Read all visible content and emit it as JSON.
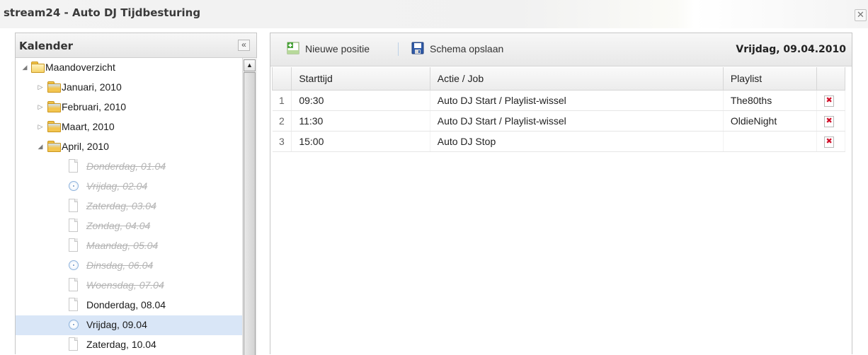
{
  "window": {
    "title": "stream24 - Auto DJ Tijdbesturing",
    "close_label": "✕"
  },
  "calendar": {
    "title": "Kalender",
    "collapse_label": "«",
    "root": "Maandoverzicht",
    "months": [
      "Januari, 2010",
      "Februari, 2010",
      "Maart, 2010",
      "April, 2010"
    ],
    "days": [
      {
        "label": "Donderdag, 01.04",
        "past": true,
        "clock": false
      },
      {
        "label": "Vrijdag, 02.04",
        "past": true,
        "clock": true
      },
      {
        "label": "Zaterdag, 03.04",
        "past": true,
        "clock": false
      },
      {
        "label": "Zondag, 04.04",
        "past": true,
        "clock": false
      },
      {
        "label": "Maandag, 05.04",
        "past": true,
        "clock": false
      },
      {
        "label": "Dinsdag, 06.04",
        "past": true,
        "clock": true
      },
      {
        "label": "Woensdag, 07.04",
        "past": true,
        "clock": false
      },
      {
        "label": "Donderdag, 08.04",
        "past": false,
        "clock": false
      },
      {
        "label": "Vrijdag, 09.04",
        "past": false,
        "clock": true,
        "selected": true
      },
      {
        "label": "Zaterdag, 10.04",
        "past": false,
        "clock": false
      }
    ]
  },
  "toolbar": {
    "new_position": "Nieuwe positie",
    "save_schedule": "Schema opslaan",
    "selected_date": "Vrijdag, 09.04.2010"
  },
  "grid": {
    "columns": [
      "Starttijd",
      "Actie / Job",
      "Playlist"
    ],
    "rows": [
      {
        "num": "1",
        "time": "09:30",
        "action": "Auto DJ Start / Playlist-wissel",
        "playlist": "The80ths"
      },
      {
        "num": "2",
        "time": "11:30",
        "action": "Auto DJ Start / Playlist-wissel",
        "playlist": "OldieNight"
      },
      {
        "num": "3",
        "time": "15:00",
        "action": "Auto DJ Stop",
        "playlist": ""
      }
    ]
  },
  "colors": {
    "selection": "#d9e6f7",
    "delete_icon": "#d0102a",
    "folder": "#f3c550"
  }
}
